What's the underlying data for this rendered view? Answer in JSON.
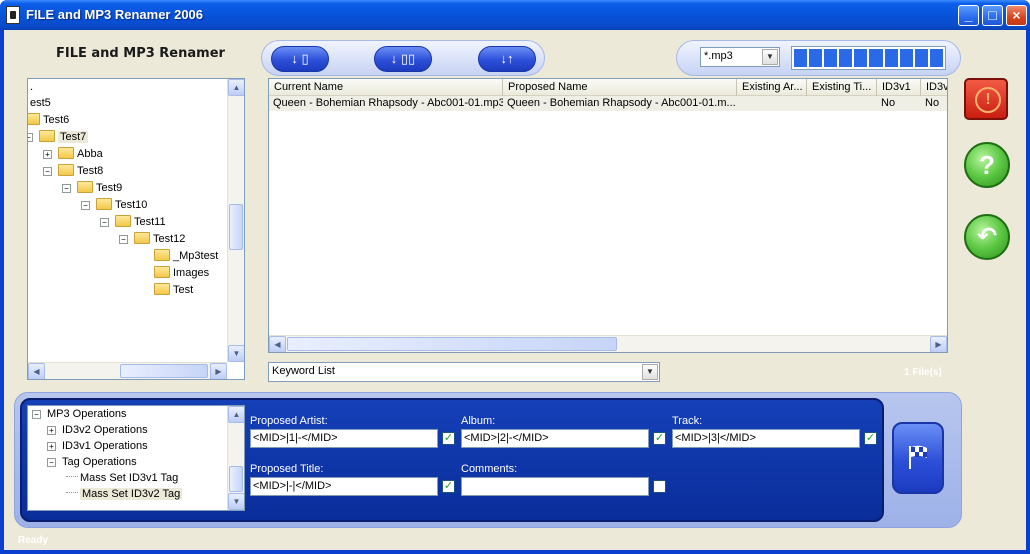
{
  "window": {
    "title": "FILE and MP3 Renamer 2006",
    "buttons": {
      "minimize": "_",
      "maximize": "□",
      "close": "×"
    }
  },
  "app_title": "FILE and MP3 Renamer",
  "toolbar": {
    "btn1_glyph": "↓",
    "btn2_glyph": "↓",
    "btn3_glyph": "↓↑"
  },
  "filter": {
    "extension": "*.mp3",
    "progress_segments": 10
  },
  "folder_tree": {
    "items": [
      {
        "label": ".",
        "level": 0
      },
      {
        "label": "est5",
        "level": 0
      },
      {
        "label": "Test6",
        "level": 0
      },
      {
        "label": "Test7",
        "level": 0,
        "selected": true
      },
      {
        "label": "Abba",
        "level": 1
      },
      {
        "label": "Test8",
        "level": 1
      },
      {
        "label": "Test9",
        "level": 2
      },
      {
        "label": "Test10",
        "level": 3
      },
      {
        "label": "Test11",
        "level": 4
      },
      {
        "label": "Test12",
        "level": 5
      },
      {
        "label": "_Mp3test",
        "level": 6
      },
      {
        "label": "Images",
        "level": 6
      },
      {
        "label": "Test",
        "level": 6
      }
    ]
  },
  "file_list": {
    "columns": [
      "Current Name",
      "Proposed Name",
      "Existing Ar...",
      "Existing Ti...",
      "ID3v1",
      "ID3v"
    ],
    "rows": [
      {
        "current": "Queen - Bohemian Rhapsody - Abc001-01.mp3",
        "proposed": "Queen - Bohemian Rhapsody - Abc001-01.m...",
        "existing_artist": "",
        "existing_title": "",
        "id3v1": "No",
        "id3v2": "No"
      }
    ]
  },
  "keyword_list": "Keyword List",
  "file_count": "1 File(s)",
  "operations_tree": {
    "items": [
      {
        "label": "MP3 Operations",
        "type": "minus"
      },
      {
        "label": "ID3v2 Operations",
        "type": "plus"
      },
      {
        "label": "ID3v1 Operations",
        "type": "plus"
      },
      {
        "label": "Tag Operations",
        "type": "minus"
      },
      {
        "label": "Mass Set ID3v1 Tag",
        "type": "leaf"
      },
      {
        "label": "Mass Set ID3v2 Tag",
        "type": "leaf",
        "selected": true
      }
    ]
  },
  "fields": {
    "artist": {
      "label": "Proposed Artist:",
      "value": "<MID>|1|-</MID>",
      "checked": true
    },
    "album": {
      "label": "Album:",
      "value": "<MID>|2|-</MID>",
      "checked": true
    },
    "track": {
      "label": "Track:",
      "value": "<MID>|3|</MID>",
      "checked": true
    },
    "title": {
      "label": "Proposed Title:",
      "value": "<MID>|-|</MID>",
      "checked": true
    },
    "comments": {
      "label": "Comments:",
      "value": "",
      "checked": false
    }
  },
  "status": "Ready",
  "colors": {
    "window_blue": "#0a3fcf",
    "panel_blue": "#1540b8",
    "help_green": "#5bc742",
    "stop_red": "#c91e10"
  }
}
